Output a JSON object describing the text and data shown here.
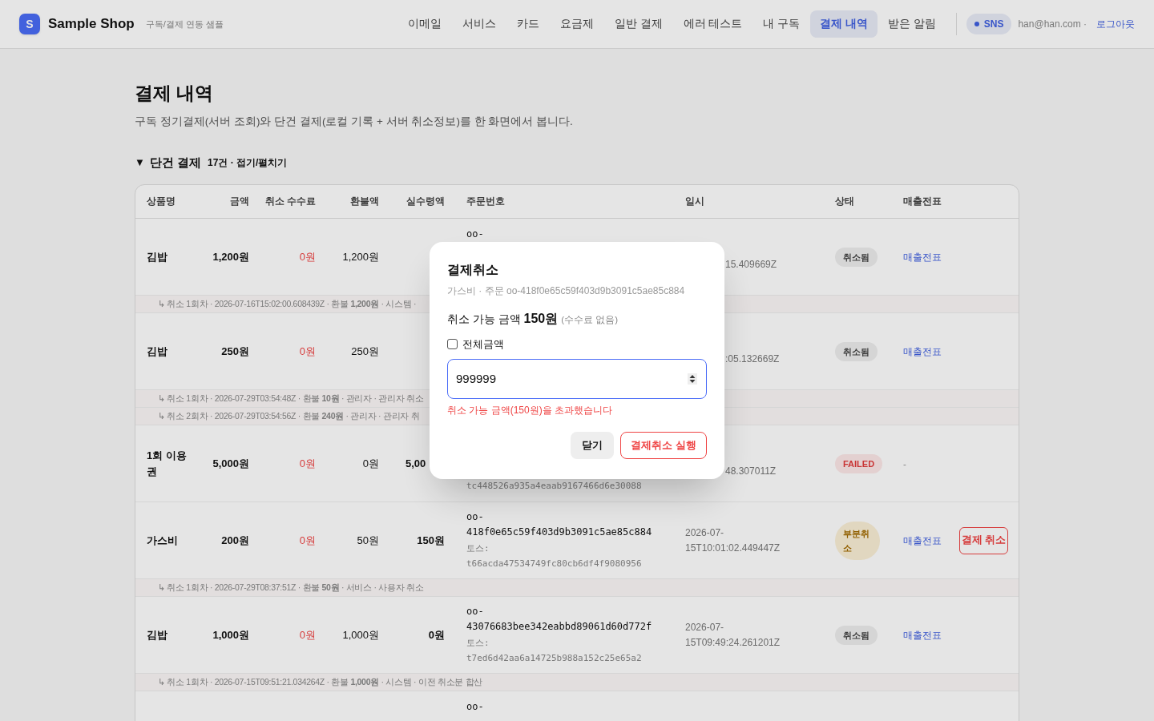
{
  "header": {
    "logo_letter": "S",
    "brand": "Sample Shop",
    "tagline": "구독/결제 연동 샘플",
    "nav": [
      {
        "label": "이메일",
        "selected": false
      },
      {
        "label": "서비스",
        "selected": false
      },
      {
        "label": "카드",
        "selected": false
      },
      {
        "label": "요금제",
        "selected": false
      },
      {
        "label": "일반 결제",
        "selected": false
      },
      {
        "label": "에러 테스트",
        "selected": false
      },
      {
        "label": "내 구독",
        "selected": false
      },
      {
        "label": "결제 내역",
        "selected": true
      },
      {
        "label": "받은 알림",
        "selected": false
      }
    ],
    "sns_badge": "SNS",
    "email": "han@han.com ·",
    "logout": "로그아웃"
  },
  "page": {
    "title": "결제 내역",
    "description": "구독 정기결제(서버 조회)와 단건 결제(로컬 기록 + 서버 취소정보)를 한 화면에서 봅니다."
  },
  "section": {
    "toggle": "▼",
    "title": "단건 결제",
    "meta": "17건 · 접기/펼치기",
    "expanded": true
  },
  "table": {
    "columns": [
      "상품명",
      "금액",
      "취소 수수료",
      "환불액",
      "실수령액",
      "주문번호",
      "일시",
      "상태",
      "매출전표"
    ],
    "rows": [
      {
        "kind": "payment",
        "name": "김밥",
        "amount": "1,200원",
        "fee": "0원",
        "refund": "1,200원",
        "order": {
          "text": "oo-",
          "hidden_end": true
        },
        "date": {
          "text": "15.409669Z",
          "hidden_start": true
        },
        "status": {
          "text": "취소됨",
          "kind": "cancelled"
        },
        "receipt": {
          "text": "매출전표",
          "kind": "link"
        }
      },
      {
        "kind": "cancel",
        "text": "↳ 취소 1회차 · 2026-07-16T15:02:00.608439Z · 환불 **1,200원** · 시스템 ·"
      },
      {
        "kind": "payment",
        "name": "김밥",
        "amount": "250원",
        "fee": "0원",
        "refund": "250원",
        "date": {
          "text": ":05.132669Z",
          "hidden_start": true
        },
        "status": {
          "text": "취소됨",
          "kind": "cancelled"
        },
        "receipt": {
          "text": "매출전표",
          "kind": "link"
        }
      },
      {
        "kind": "cancel",
        "text": "↳ 취소 1회차 · 2026-07-29T03:54:48Z · 환불 **10원** · 관리자 · 관리자 취소"
      },
      {
        "kind": "cancel",
        "text": "↳ 취소 2회차 · 2026-07-29T03:54:56Z · 환불 **240원** · 관리자 · 관리자 취"
      },
      {
        "kind": "payment",
        "name": "1회 이용권",
        "amount": "5,000원",
        "fee": "0원",
        "refund": "0원",
        "net": {
          "text": "5,00",
          "hidden_end": true
        },
        "order": {
          "toss": "tc448526a935a4eaab9167466d6e30088",
          "hidden_start": true
        },
        "date": {
          "text": "48.307011Z",
          "hidden_start": true
        },
        "status": {
          "text": "FAILED",
          "kind": "failed"
        },
        "receipt": {
          "text": "-",
          "kind": "none"
        }
      },
      {
        "kind": "payment",
        "name": "가스비",
        "amount": "200원",
        "fee": "0원",
        "refund": "50원",
        "net": {
          "text": "150원"
        },
        "order": {
          "text": "oo-418f0e65c59f403d9b3091c5ae85c884",
          "toss": "토스: t66acda47534749fc80cb6df4f9080956"
        },
        "date": {
          "text": "2026-07-15T10:01:02.449447Z"
        },
        "status": {
          "text": "부분취소",
          "kind": "partial"
        },
        "receipt": {
          "text": "매출전표",
          "kind": "link"
        },
        "action": "결제 취소"
      },
      {
        "kind": "cancel",
        "text": "↳ 취소 1회차 · 2026-07-29T08:37:51Z · 환불 **50원** · 서비스 · 사용자 취소"
      },
      {
        "kind": "payment",
        "name": "김밥",
        "amount": "1,000원",
        "fee": "0원",
        "refund": "1,000원",
        "net": {
          "text": "0원"
        },
        "order": {
          "text": "oo-43076683bee342eabbd89061d60d772f",
          "toss": "토스: t7ed6d42aa6a14725b988a152c25e65a2"
        },
        "date": {
          "text": "2026-07-15T09:49:24.261201Z"
        },
        "status": {
          "text": "취소됨",
          "kind": "cancelled"
        },
        "receipt": {
          "text": "매출전표",
          "kind": "link"
        }
      },
      {
        "kind": "cancel",
        "text": "↳ 취소 1회차 · 2026-07-15T09:51:21.034264Z · 환불 **1,000원** · 시스템 · 이전 취소분 합산"
      },
      {
        "kind": "payment",
        "order": {
          "text": "oo-",
          "hidden_end": true
        }
      }
    ]
  },
  "modal": {
    "title": "결제취소",
    "subtitle": "가스비 · 주문 oo-418f0e65c59f403d9b3091c5ae85c884",
    "available_label": "취소 가능 금액",
    "available_amount": "150원",
    "available_note": "(수수료 없음)",
    "full_amount": {
      "label": "전체금액",
      "checked": false
    },
    "amount_value": "999999",
    "error": "취소 가능 금액(150원)을 초과했습니다",
    "buttons": [
      {
        "label": "닫기",
        "kind": "secondary"
      },
      {
        "label": "결제취소 실행",
        "kind": "danger"
      }
    ]
  }
}
